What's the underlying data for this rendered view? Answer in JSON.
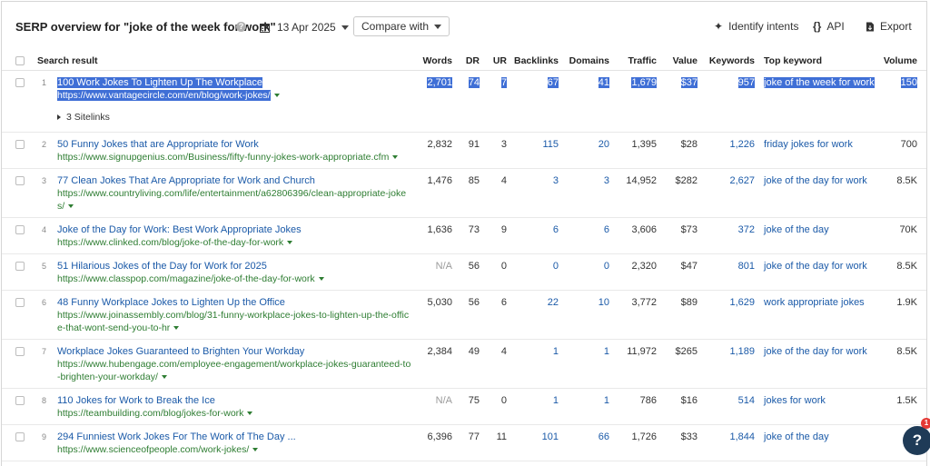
{
  "header": {
    "title": "SERP overview for \"joke of the week for work\"",
    "date": "13 Apr 2025",
    "compare_label": "Compare with",
    "identify_label": "Identify intents",
    "api_label": "API",
    "export_label": "Export"
  },
  "columns": {
    "result": "Search result",
    "words": "Words",
    "dr": "DR",
    "ur": "UR",
    "backlinks": "Backlinks",
    "domains": "Domains",
    "traffic": "Traffic",
    "value": "Value",
    "keywords": "Keywords",
    "top_keyword": "Top keyword",
    "volume": "Volume"
  },
  "rows": [
    {
      "idx": "1",
      "title": "100 Work Jokes To Lighten Up The Workplace",
      "url": "https://www.vantagecircle.com/en/blog/work-jokes/",
      "sitelinks": "3 Sitelinks",
      "words": "2,701",
      "dr": "74",
      "ur": "7",
      "backlinks": "67",
      "domains": "41",
      "traffic": "1,679",
      "value": "$37",
      "keywords": "957",
      "top_keyword": "joke of the week for work",
      "volume": "150"
    },
    {
      "idx": "2",
      "title": "50 Funny Jokes that are Appropriate for Work",
      "url": "https://www.signupgenius.com/Business/fifty-funny-jokes-work-appropriate.cfm",
      "words": "2,832",
      "dr": "91",
      "ur": "3",
      "backlinks": "115",
      "domains": "20",
      "traffic": "1,395",
      "value": "$28",
      "keywords": "1,226",
      "top_keyword": "friday jokes for work",
      "volume": "700"
    },
    {
      "idx": "3",
      "title": "77 Clean Jokes That Are Appropriate for Work and Church",
      "url": "https://www.countryliving.com/life/entertainment/a62806396/clean-appropriate-jokes/",
      "words": "1,476",
      "dr": "85",
      "ur": "4",
      "backlinks": "3",
      "domains": "3",
      "traffic": "14,952",
      "value": "$282",
      "keywords": "2,627",
      "top_keyword": "joke of the day for work",
      "volume": "8.5K"
    },
    {
      "idx": "4",
      "title": "Joke of the Day for Work: Best Work Appropriate Jokes",
      "url": "https://www.clinked.com/blog/joke-of-the-day-for-work",
      "words": "1,636",
      "dr": "73",
      "ur": "9",
      "backlinks": "6",
      "domains": "6",
      "traffic": "3,606",
      "value": "$73",
      "keywords": "372",
      "top_keyword": "joke of the day",
      "volume": "70K"
    },
    {
      "idx": "5",
      "title": "51 Hilarious Jokes of the Day for Work for 2025",
      "url": "https://www.classpop.com/magazine/joke-of-the-day-for-work",
      "words": "N/A",
      "dr": "56",
      "ur": "0",
      "backlinks": "0",
      "domains": "0",
      "traffic": "2,320",
      "value": "$47",
      "keywords": "801",
      "top_keyword": "joke of the day for work",
      "volume": "8.5K"
    },
    {
      "idx": "6",
      "title": "48 Funny Workplace Jokes to Lighten Up the Office",
      "url": "https://www.joinassembly.com/blog/31-funny-workplace-jokes-to-lighten-up-the-office-that-wont-send-you-to-hr",
      "words": "5,030",
      "dr": "56",
      "ur": "6",
      "backlinks": "22",
      "domains": "10",
      "traffic": "3,772",
      "value": "$89",
      "keywords": "1,629",
      "top_keyword": "work appropriate jokes",
      "volume": "1.9K"
    },
    {
      "idx": "7",
      "title": "Workplace Jokes Guaranteed to Brighten Your Workday",
      "url": "https://www.hubengage.com/employee-engagement/workplace-jokes-guaranteed-to-brighten-your-workday/",
      "words": "2,384",
      "dr": "49",
      "ur": "4",
      "backlinks": "1",
      "domains": "1",
      "traffic": "11,972",
      "value": "$265",
      "keywords": "1,189",
      "top_keyword": "joke of the day for work",
      "volume": "8.5K"
    },
    {
      "idx": "8",
      "title": "110 Jokes for Work to Break the Ice",
      "url": "https://teambuilding.com/blog/jokes-for-work",
      "words": "N/A",
      "dr": "75",
      "ur": "0",
      "backlinks": "1",
      "domains": "1",
      "traffic": "786",
      "value": "$16",
      "keywords": "514",
      "top_keyword": "jokes for work",
      "volume": "1.5K"
    },
    {
      "idx": "9",
      "title": "294 Funniest Work Jokes For The Work of The Day ...",
      "url": "https://www.scienceofpeople.com/work-jokes/",
      "words": "6,396",
      "dr": "77",
      "ur": "11",
      "backlinks": "101",
      "domains": "66",
      "traffic": "1,726",
      "value": "$33",
      "keywords": "1,844",
      "top_keyword": "joke of the day",
      "volume": "7"
    }
  ],
  "help": {
    "label": "?",
    "badge": "1"
  }
}
